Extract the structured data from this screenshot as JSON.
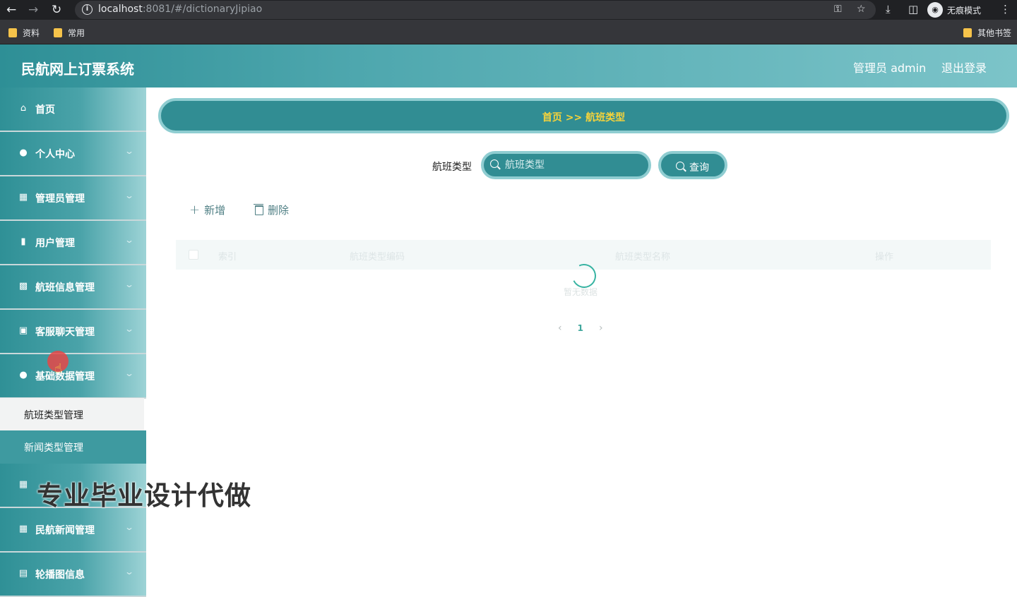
{
  "browser": {
    "url_host": "localhost",
    "url_rest": ":8081/#/dictionaryJipiao",
    "incognito_label": "无痕模式",
    "bookmarks": [
      "资料",
      "常用"
    ],
    "other_bookmarks": "其他书签"
  },
  "header": {
    "title": "民航网上订票系统",
    "user": "管理员 admin",
    "logout": "退出登录"
  },
  "sidebar": {
    "items": [
      {
        "label": "首页",
        "icon": "home-icon"
      },
      {
        "label": "个人中心",
        "icon": "user-icon"
      },
      {
        "label": "管理员管理",
        "icon": "grid-icon"
      },
      {
        "label": "用户管理",
        "icon": "chart-icon"
      },
      {
        "label": "航班信息管理",
        "icon": "monitor-icon"
      },
      {
        "label": "客服聊天管理",
        "icon": "chat-icon"
      },
      {
        "label": "基础数据管理",
        "icon": "user-icon"
      },
      {
        "label": "民航新闻管理",
        "icon": "grid-icon"
      },
      {
        "label": "轮播图信息",
        "icon": "clipboard-icon"
      }
    ],
    "submenu": {
      "active": "航班类型管理",
      "other": "新闻类型管理"
    },
    "watermark": "专业毕业设计代做"
  },
  "main": {
    "breadcrumb": "首页  >>  航班类型",
    "search": {
      "label": "航班类型",
      "placeholder": "航班类型",
      "button": "查询"
    },
    "actions": {
      "add": "新增",
      "delete": "删除"
    },
    "table": {
      "columns": [
        "索引",
        "航班类型编码",
        "航班类型名称",
        "操作"
      ],
      "empty_text": "暂无数据"
    },
    "pagination": {
      "current": "1"
    }
  }
}
